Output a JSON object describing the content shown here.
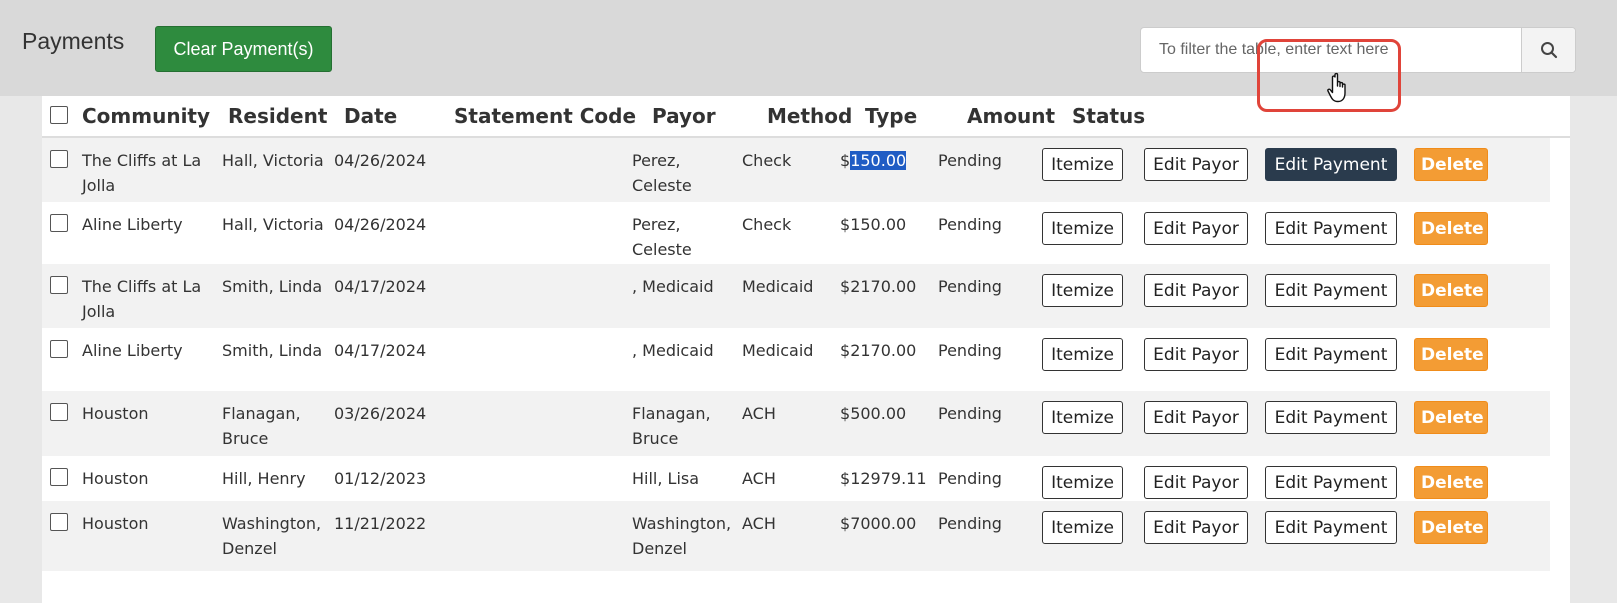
{
  "header": {
    "title": "Payments",
    "clear_label": "Clear Payment(s)",
    "search_placeholder": "To filter the table, enter text here",
    "search_icon": "search-icon"
  },
  "columns": [
    "Community",
    "Resident",
    "Date",
    "Statement Code",
    "Payor",
    "Method",
    "Type",
    "Amount",
    "Status"
  ],
  "actions": {
    "itemize": "Itemize",
    "edit_payor": "Edit Payor",
    "edit_payment": "Edit Payment",
    "delete": "Delete"
  },
  "colors": {
    "clear_button": "#2e8b3e",
    "delete_button": "#f39c34",
    "active_button": "#2a3b4d",
    "selection": "#1f5cc4",
    "focus_ring": "#e0443a"
  },
  "rows": [
    {
      "community": "The Cliffs at La Jolla",
      "resident": "Hall, Victoria",
      "date": "04/26/2024",
      "statement_code": "",
      "payor": "Perez, Celeste",
      "method": "Check",
      "type_dollar": "$",
      "type_num": "150.00",
      "status": "Pending"
    },
    {
      "community": "Aline Liberty",
      "resident": "Hall, Victoria",
      "date": "04/26/2024",
      "statement_code": "",
      "payor": "Perez, Celeste",
      "method": "Check",
      "type_dollar": "$",
      "type_num": "150.00",
      "status": "Pending"
    },
    {
      "community": "The Cliffs at La Jolla",
      "resident": "Smith, Linda",
      "date": "04/17/2024",
      "statement_code": "",
      "payor": ", Medicaid",
      "method": "Medicaid",
      "type_dollar": "$",
      "type_num": "2170.00",
      "status": "Pending"
    },
    {
      "community": "Aline Liberty",
      "resident": "Smith, Linda",
      "date": "04/17/2024",
      "statement_code": "",
      "payor": ", Medicaid",
      "method": "Medicaid",
      "type_dollar": "$",
      "type_num": "2170.00",
      "status": "Pending"
    },
    {
      "community": "Houston",
      "resident": "Flanagan, Bruce",
      "date": "03/26/2024",
      "statement_code": "",
      "payor": "Flanagan, Bruce",
      "method": "ACH",
      "type_dollar": "$",
      "type_num": "500.00",
      "status": "Pending"
    },
    {
      "community": "Houston",
      "resident": "Hill, Henry",
      "date": "01/12/2023",
      "statement_code": "",
      "payor": "Hill, Lisa",
      "method": "ACH",
      "type_dollar": "$",
      "type_num": "12979.11",
      "status": "Pending"
    },
    {
      "community": "Houston",
      "resident": "Washington, Denzel",
      "date": "11/21/2022",
      "statement_code": "",
      "payor": "Washington, Denzel",
      "method": "ACH",
      "type_dollar": "$",
      "type_num": "7000.00",
      "status": "Pending"
    }
  ]
}
